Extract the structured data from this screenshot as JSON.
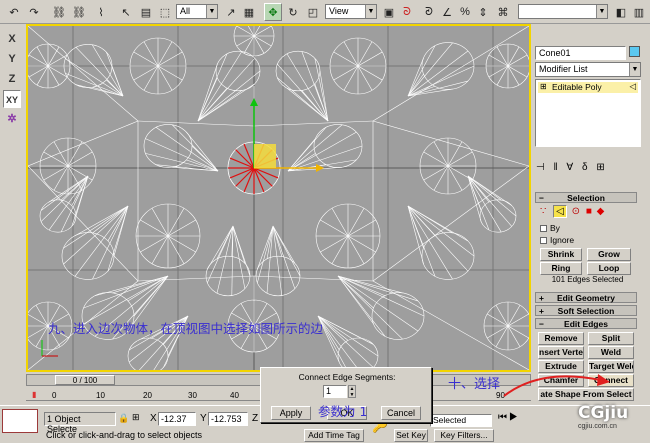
{
  "toolbar": {
    "selection_filter": "All",
    "ref_coord": "View",
    "named_selection": ""
  },
  "left_toolbar": [
    "X",
    "Y",
    "Z",
    "XY"
  ],
  "object_name": "Cone01",
  "modifier_list": "Modifier List",
  "stack_item": "Editable Poly",
  "selection_rollout": {
    "title": "Selection",
    "by_label": "By",
    "ignore_label": "Ignore",
    "shrink": "Shrink",
    "grow": "Grow",
    "ring": "Ring",
    "loop": "Loop",
    "status": "101 Edges Selected"
  },
  "rollouts": {
    "edit_geometry": "Edit Geometry",
    "soft_selection": "Soft Selection",
    "edit_edges": "Edit Edges"
  },
  "edit_edges": {
    "remove": "Remove",
    "split": "Split",
    "insert_vertex": "nsert Verte:",
    "weld": "Weld",
    "extrude": "Extrude",
    "target_weld": "Target Weld",
    "chamfer": "Chamfer",
    "connect": "Connect",
    "create_shape": "ate Shape From Select"
  },
  "dialog": {
    "title": "Connect Edge Segments:",
    "value": "1",
    "apply": "Apply",
    "ok": "OK",
    "cancel": "Cancel"
  },
  "annotations": {
    "step9": "九、进入边次物体，在顶视图中选择如图所示的边",
    "step10": "十、选择",
    "param": "参数为 1"
  },
  "timeline": {
    "frame_counter": "0 / 100",
    "ticks": [
      "0",
      "10",
      "20",
      "30",
      "40",
      "90"
    ]
  },
  "status": {
    "objects_selected": "1 Object Selecte",
    "x_label": "X",
    "x_value": "-12.37",
    "y_label": "Y",
    "y_value": "-12.753",
    "z_label": "Z",
    "prompt": "Click or click-and-drag to select objects",
    "add_time_tag": "Add Time Tag",
    "selected_dropdown": "Selected",
    "set_key": "Set Key",
    "key_filters": "Key Filters..."
  },
  "watermark": {
    "brand": "CGjiu",
    "url": "cgjiu.com.cn"
  },
  "colors": {
    "viewport_bg": "#9e9e9e",
    "viewport_border": "#f2d400",
    "annotation": "#3a2fd0",
    "selected_edges": "#e01010",
    "accent": "#5bc8f0"
  }
}
